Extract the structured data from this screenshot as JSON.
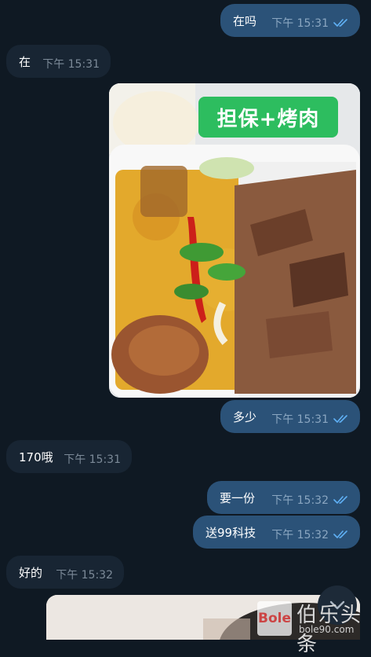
{
  "messages": [
    {
      "text": "在吗",
      "time": "下午 15:31"
    },
    {
      "text": "在",
      "time": "下午 15:31"
    },
    {
      "text": "多少",
      "time": "下午 15:31"
    },
    {
      "text": "170哦",
      "time": "下午 15:31"
    },
    {
      "text": "要一份",
      "time": "下午 15:32"
    },
    {
      "text": "送99科技",
      "time": "下午 15:32"
    },
    {
      "text": "好的",
      "time": "下午 15:32"
    }
  ],
  "photo": {
    "overlay_text": "担保+烤肉"
  },
  "watermark": {
    "logo": "Bole",
    "title": "伯乐头条",
    "url": "bole90.com"
  },
  "colors": {
    "background": "#0f1923",
    "outgoing": "#2b5278",
    "incoming": "#182533",
    "ticks": "#5fb0f5"
  }
}
